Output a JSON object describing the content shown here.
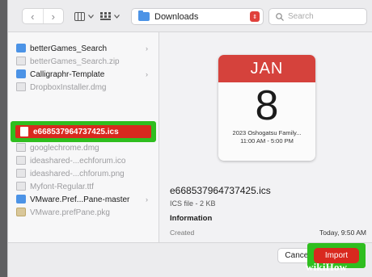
{
  "toolbar": {
    "back": "‹",
    "forward": "›",
    "location": "Downloads",
    "search_placeholder": "Search"
  },
  "files": [
    {
      "name": "betterGames_Search",
      "kind": "folder",
      "dim": false,
      "chevron": "›"
    },
    {
      "name": "betterGames_Search.zip",
      "kind": "doc",
      "dim": true
    },
    {
      "name": "Calligraphr-Template",
      "kind": "folder",
      "dim": false,
      "chevron": "›"
    },
    {
      "name": "DropboxInstaller.dmg",
      "kind": "doc",
      "dim": true
    },
    {
      "name": "e668537964737425.ics",
      "kind": "ics",
      "dim": false,
      "selected": true
    },
    {
      "name": "googlechrome.dmg",
      "kind": "doc",
      "dim": true
    },
    {
      "name": "ideashared-...echforum.ico",
      "kind": "doc",
      "dim": true
    },
    {
      "name": "ideashared-...chforum.png",
      "kind": "doc",
      "dim": true
    },
    {
      "name": "Myfont-Regular.ttf",
      "kind": "doc",
      "dim": true
    },
    {
      "name": "VMware.Pref...Pane-master",
      "kind": "folder",
      "dim": false,
      "chevron": "›"
    },
    {
      "name": "VMware.prefPane.pkg",
      "kind": "pkg",
      "dim": true
    }
  ],
  "preview": {
    "month": "JAN",
    "day": "8",
    "event_title": "2023 Oshogatsu Family...",
    "event_time": "11:00 AM - 5:00 PM",
    "filename": "e668537964737425.ics",
    "kind": "ICS file - 2 KB",
    "info_heading": "Information",
    "created_label": "Created",
    "created_value": "Today, 9:50 AM"
  },
  "footer": {
    "cancel_label": "Cancel",
    "import_label": "Import"
  },
  "watermark": "wikiHow",
  "colors": {
    "highlight_green": "#2fbe1f",
    "highlight_red": "#d9291f",
    "calendar_red": "#d5423c",
    "folder_blue": "#4c93e6"
  }
}
